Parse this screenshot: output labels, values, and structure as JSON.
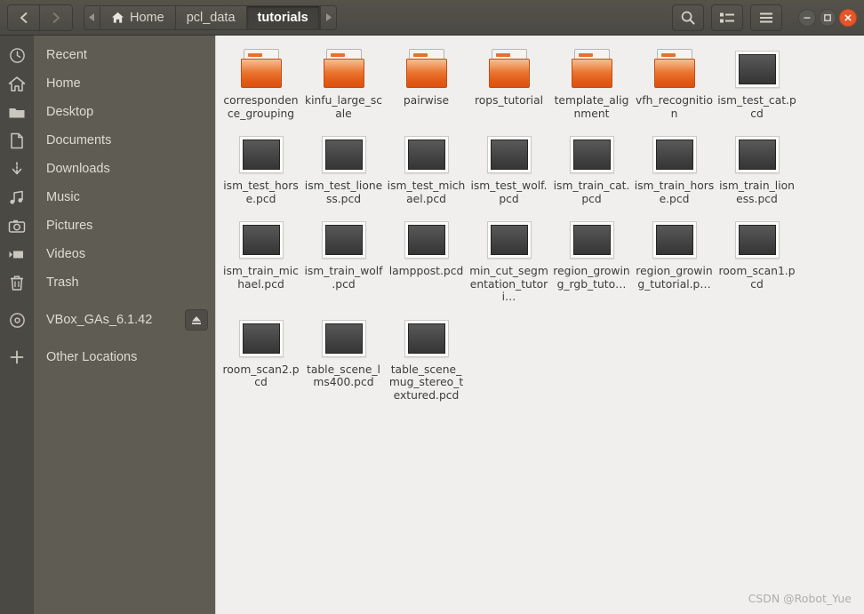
{
  "window": {
    "title": "tutorials",
    "accent_color": "#e4572a",
    "header_bg": "#4b4944",
    "sidebar_bg": "#5f5d53",
    "content_bg": "#f0efee"
  },
  "header": {
    "back_button": "Back",
    "forward_button": "Forward",
    "path_prev_label": "Previous path",
    "path_next_label": "Next path",
    "breadcrumbs": [
      {
        "label": "Home",
        "icon": "home-icon",
        "active": false
      },
      {
        "label": "pcl_data",
        "icon": "",
        "active": false
      },
      {
        "label": "tutorials",
        "icon": "",
        "active": true
      }
    ],
    "search_label": "Search",
    "view_toggle_label": "List view",
    "menu_label": "Menu",
    "minimize_label": "Minimize",
    "maximize_label": "Maximize",
    "close_label": "Close"
  },
  "sidebar": {
    "items": [
      {
        "label": "Recent",
        "icon": "clock-icon"
      },
      {
        "label": "Home",
        "icon": "home-icon"
      },
      {
        "label": "Desktop",
        "icon": "folder-icon"
      },
      {
        "label": "Documents",
        "icon": "document-icon"
      },
      {
        "label": "Downloads",
        "icon": "download-icon"
      },
      {
        "label": "Music",
        "icon": "music-icon"
      },
      {
        "label": "Pictures",
        "icon": "camera-icon"
      },
      {
        "label": "Videos",
        "icon": "video-icon"
      },
      {
        "label": "Trash",
        "icon": "trash-icon"
      },
      {
        "label": "VBox_GAs_6.1.42",
        "icon": "disc-icon",
        "eject": true
      },
      {
        "label": "Other Locations",
        "icon": "plus-icon"
      }
    ],
    "eject_label": "Eject"
  },
  "files": [
    {
      "name": "correspondence_grouping",
      "display": "correspondence_grouping",
      "type": "folder"
    },
    {
      "name": "kinfu_large_scale",
      "display": "kinfu_large_scale",
      "type": "folder"
    },
    {
      "name": "pairwise",
      "display": "pairwise",
      "type": "folder"
    },
    {
      "name": "rops_tutorial",
      "display": "rops_tutorial",
      "type": "folder"
    },
    {
      "name": "template_alignment",
      "display": "template_alignment",
      "type": "folder"
    },
    {
      "name": "vfh_recognition",
      "display": "vfh_recognition",
      "type": "folder"
    },
    {
      "name": "ism_test_cat.pcd",
      "display": "ism_test_cat.pcd",
      "type": "pcd"
    },
    {
      "name": "ism_test_horse.pcd",
      "display": "ism_test_horse.pcd",
      "type": "pcd"
    },
    {
      "name": "ism_test_lioness.pcd",
      "display": "ism_test_lioness.pcd",
      "type": "pcd"
    },
    {
      "name": "ism_test_michael.pcd",
      "display": "ism_test_michael.pcd",
      "type": "pcd"
    },
    {
      "name": "ism_test_wolf.pcd",
      "display": "ism_test_wolf.pcd",
      "type": "pcd"
    },
    {
      "name": "ism_train_cat.pcd",
      "display": "ism_train_cat.pcd",
      "type": "pcd"
    },
    {
      "name": "ism_train_horse.pcd",
      "display": "ism_train_horse.pcd",
      "type": "pcd"
    },
    {
      "name": "ism_train_lioness.pcd",
      "display": "ism_train_lioness.pcd",
      "type": "pcd"
    },
    {
      "name": "ism_train_michael.pcd",
      "display": "ism_train_michael.pcd",
      "type": "pcd"
    },
    {
      "name": "ism_train_wolf.pcd",
      "display": "ism_train_wolf.pcd",
      "type": "pcd"
    },
    {
      "name": "lamppost.pcd",
      "display": "lamppost.pcd",
      "type": "pcd"
    },
    {
      "name": "min_cut_segmentation_tutorial.pcd",
      "display": "min_cut_segmentation_tutori…",
      "type": "pcd"
    },
    {
      "name": "region_growing_rgb_tutorial.pcd",
      "display": "region_growing_rgb_tuto…",
      "type": "pcd"
    },
    {
      "name": "region_growing_tutorial.pcd",
      "display": "region_growing_tutorial.p…",
      "type": "pcd"
    },
    {
      "name": "room_scan1.pcd",
      "display": "room_scan1.pcd",
      "type": "pcd"
    },
    {
      "name": "room_scan2.pcd",
      "display": "room_scan2.pcd",
      "type": "pcd"
    },
    {
      "name": "table_scene_lms400.pcd",
      "display": "table_scene_lms400.pcd",
      "type": "pcd"
    },
    {
      "name": "table_scene_mug_stereo_textured.pcd",
      "display": "table_scene_mug_stereo_textured.pcd",
      "type": "pcd"
    }
  ],
  "watermark": "CSDN @Robot_Yue"
}
